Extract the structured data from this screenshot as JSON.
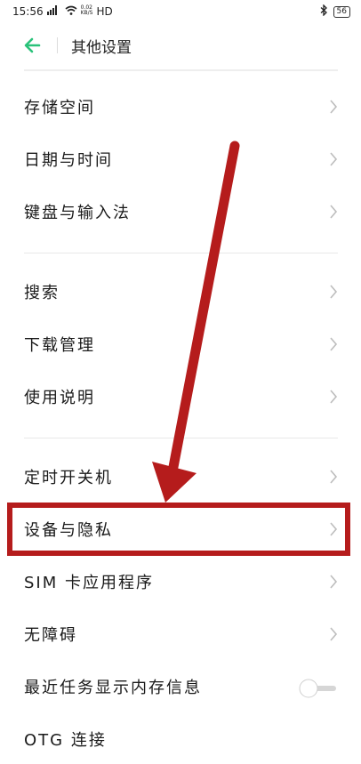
{
  "status_bar": {
    "time": "15:56",
    "signal_text": "ᵸ",
    "speed_value": "0.02",
    "speed_unit": "KB/S",
    "network": "HD",
    "battery": "56"
  },
  "header": {
    "title": "其他设置"
  },
  "settings": {
    "items": [
      {
        "label": "存储空间"
      },
      {
        "label": "日期与时间"
      },
      {
        "label": "键盘与输入法"
      },
      {
        "label": "搜索"
      },
      {
        "label": "下载管理"
      },
      {
        "label": "使用说明"
      },
      {
        "label": "定时开关机"
      },
      {
        "label": "设备与隐私"
      },
      {
        "label": "SIM 卡应用程序"
      },
      {
        "label": "无障碍"
      },
      {
        "label": "最近任务显示内存信息",
        "toggle_on": false
      },
      {
        "label": "OTG 连接"
      }
    ]
  },
  "colors": {
    "accent": "#2ac27a",
    "annotation": "#b51c1c",
    "chevron": "#bdbdbd"
  },
  "icons": [
    "back-arrow-icon",
    "chevron-right-icon",
    "bluetooth-icon",
    "wifi-icon",
    "signal-icon",
    "battery-icon"
  ]
}
